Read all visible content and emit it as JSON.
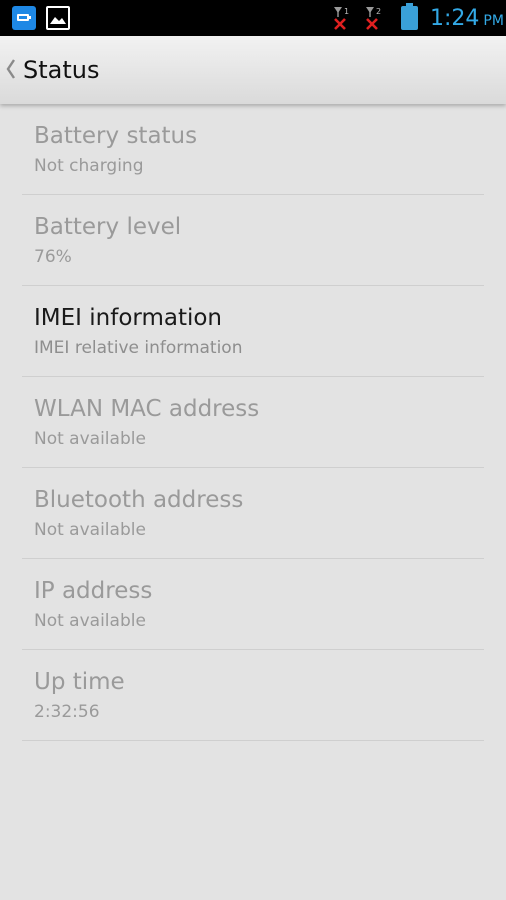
{
  "status_bar": {
    "time": "1:24",
    "ampm": "PM",
    "sim1_label": "1",
    "sim2_label": "2"
  },
  "action_bar": {
    "title": "Status"
  },
  "items": [
    {
      "title": "Battery status",
      "subtitle": "Not charging"
    },
    {
      "title": "Battery level",
      "subtitle": "76%"
    },
    {
      "title": "IMEI information",
      "subtitle": "IMEI relative information"
    },
    {
      "title": "WLAN MAC address",
      "subtitle": "Not available"
    },
    {
      "title": "Bluetooth address",
      "subtitle": "Not available"
    },
    {
      "title": "IP address",
      "subtitle": "Not available"
    },
    {
      "title": "Up time",
      "subtitle": "2:32:56"
    }
  ],
  "colors": {
    "accent": "#33a9e6",
    "background": "#e3e3e3",
    "disabled_text": "#9a9a9a",
    "enabled_text": "#1a1a1a"
  }
}
